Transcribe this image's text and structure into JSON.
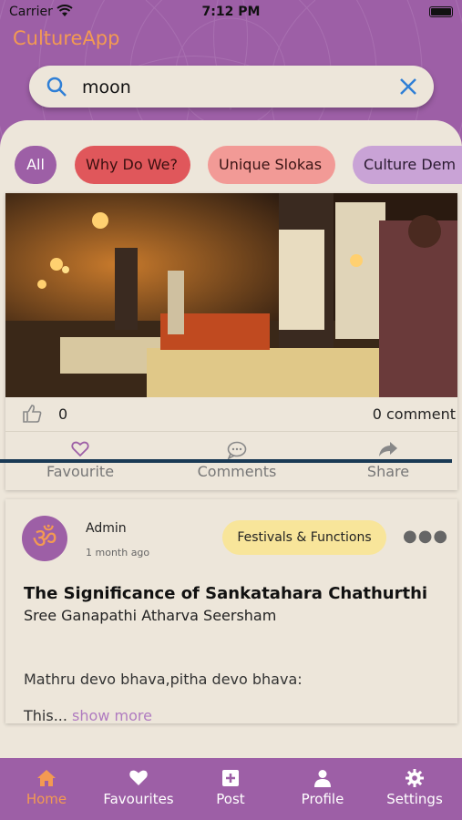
{
  "status_bar": {
    "carrier": "Carrier",
    "time": "7:12 PM"
  },
  "app": {
    "title": "CultureApp"
  },
  "search": {
    "value": "moon"
  },
  "chips": [
    "All",
    "Why Do We?",
    "Unique Slokas",
    "Culture Dem"
  ],
  "post1": {
    "likes": "0",
    "comments": "0 comment",
    "actions": {
      "favourite": "Favourite",
      "comments": "Comments",
      "share": "Share"
    }
  },
  "post2": {
    "author": "Admin",
    "time_ago": "1 month ago",
    "category": "Festivals & Functions",
    "title": "The Significance of Sankatahara Chathurthi",
    "subtitle": "Sree Ganapathi Atharva Seersham",
    "body": "Mathru devo bhava,pitha devo bhava:",
    "excerpt": "This...",
    "show_more": "show more"
  },
  "nav": {
    "home": "Home",
    "favourites": "Favourites",
    "post": "Post",
    "profile": "Profile",
    "settings": "Settings"
  },
  "colors": {
    "brand": "#9d5fa6",
    "accent": "#f39a52",
    "background": "#ede6da"
  }
}
